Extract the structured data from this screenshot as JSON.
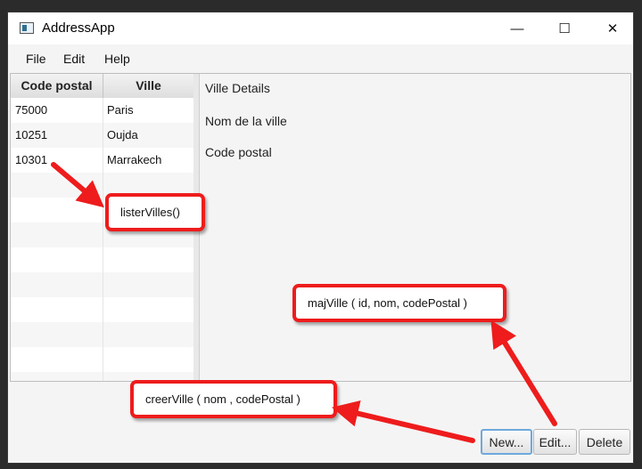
{
  "window": {
    "title": "AddressApp",
    "controls": {
      "minimize": "—",
      "maximize": "☐",
      "close": "✕"
    }
  },
  "menu": [
    "File",
    "Edit",
    "Help"
  ],
  "table": {
    "columns": [
      "Code postal",
      "Ville"
    ],
    "rows": [
      [
        "75000",
        "Paris"
      ],
      [
        "10251",
        "Oujda"
      ],
      [
        "10301",
        "Marrakech"
      ]
    ]
  },
  "details": {
    "heading": "Ville Details",
    "fields": [
      "Nom de la ville",
      "Code postal"
    ]
  },
  "buttons": {
    "new": "New...",
    "edit": "Edit...",
    "delete": "Delete"
  },
  "annotations": {
    "lister": "listerVilles()",
    "maj": "majVille ( id, nom, codePostal )",
    "creer": "creerVille ( nom , codePostal )"
  },
  "colors": {
    "annotation_border": "#ee1c1c",
    "focus_ring": "#6fa8dc"
  }
}
